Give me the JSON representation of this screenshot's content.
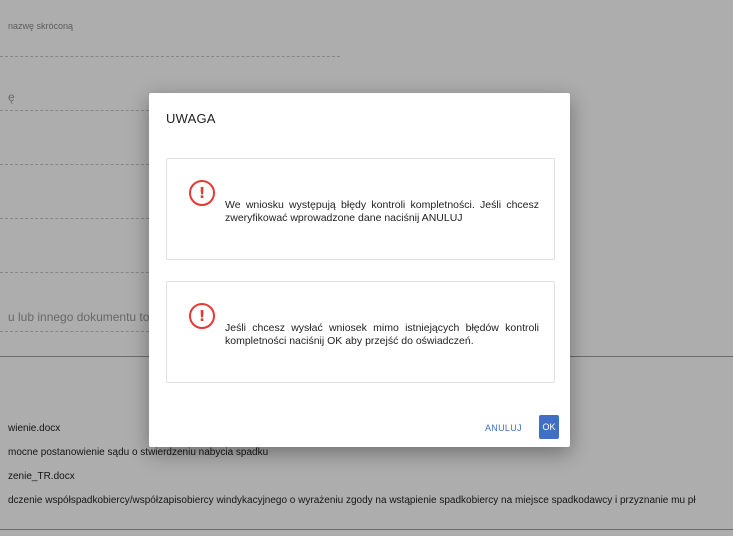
{
  "background_form": {
    "fields": [
      {
        "label": "nazwę skróconą"
      },
      {
        "label": "ę"
      },
      {
        "label": ""
      },
      {
        "label": ""
      },
      {
        "label": "u lub innego dokumentu tożs"
      }
    ],
    "files": [
      "wienie.docx",
      "mocne postanowienie sądu o stwierdzeniu nabycia spadku",
      "zenie_TR.docx",
      "dczenie współspadkobiercy/współzapisobiercy windykacyjnego o wyrażeniu zgody na wstąpienie spadkobiercy na miejsce spadkodawcy i przyznanie mu pł"
    ]
  },
  "dialog": {
    "title": "UWAGA",
    "messages": [
      {
        "icon": "error-circle-icon",
        "icon_glyph": "!",
        "text": "We wniosku występują błędy kontroli kompletności. Jeśli chcesz zweryfikować wprowadzone dane naciśnij ANULUJ"
      },
      {
        "icon": "error-circle-icon",
        "icon_glyph": "!",
        "text": "Jeśli chcesz wysłać wniosek mimo istniejących błędów kontroli kompletności naciśnij OK aby przejść do oświadczeń."
      }
    ],
    "cancel_label": "ANULUJ",
    "ok_label": "OK"
  },
  "colors": {
    "accent": "#3f6fc6",
    "error": "#e53935"
  }
}
